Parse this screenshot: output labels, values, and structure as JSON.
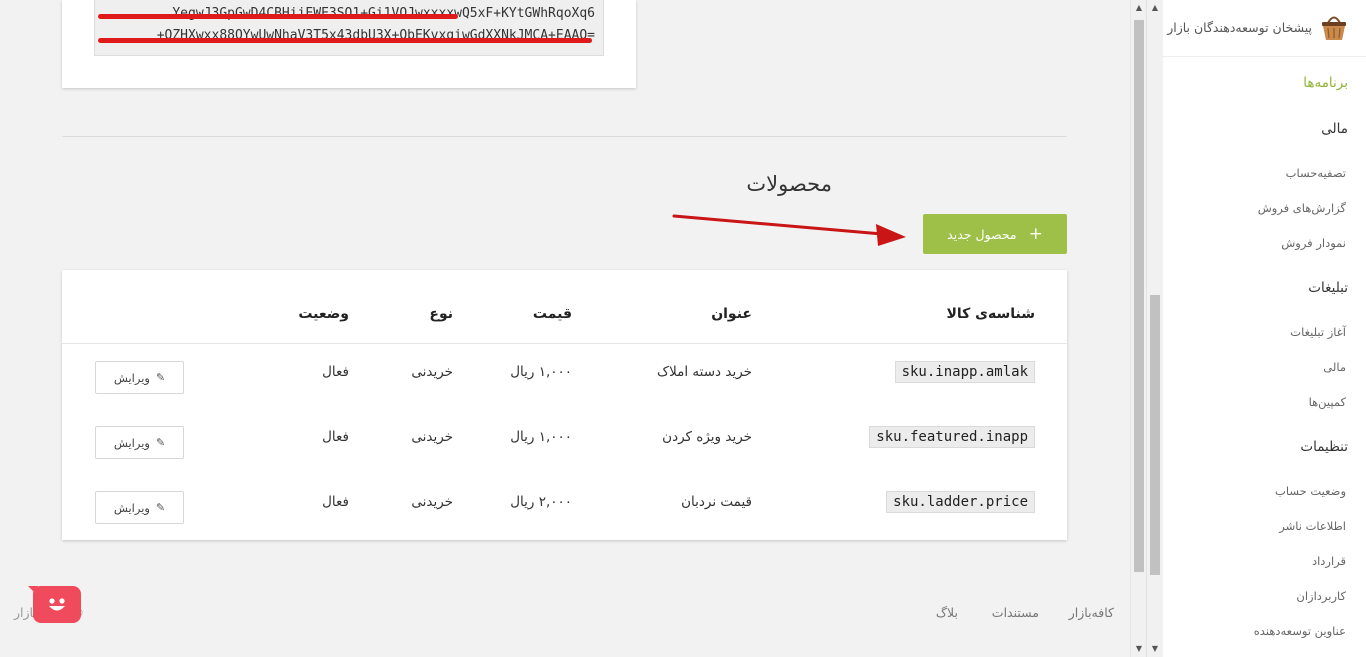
{
  "sidebar": {
    "brand": "پیشخان توسعه‌دهندگان بازار",
    "sections": [
      {
        "label": "برنامه‌ها",
        "active": true
      },
      {
        "label": "مالی"
      },
      {
        "label": "تبلیغات"
      },
      {
        "label": "تنظیمات"
      }
    ],
    "finance_items": [
      "تصفیه‌حساب",
      "گزارش‌های فروش",
      "نمودار فروش"
    ],
    "ads_items": [
      "آغاز تبلیغات",
      "مالی",
      "کمپین‌ها"
    ],
    "settings_items": [
      "وضعیت حساب",
      "اطلاعات ناشر",
      "قرارداد",
      "کاربردازان",
      "عناوین توسعه‌دهنده"
    ]
  },
  "key_card": {
    "line1": "YegwJ3GpGwD4CBHiiEWE3SQ1+Gi1VOJwxxxxwQ5xF+KYtGWhRqoXq6",
    "line2": "+OZHXwxx88QYwUwNhaV3T5x43dbU3X+QbEKvxqiwGdXXNkJMCA+EAAQ="
  },
  "products": {
    "title": "محصولات",
    "new_button": "محصول جدید",
    "headers": {
      "sku": "شناسه‌ی کالا",
      "title": "عنوان",
      "price": "قیمت",
      "type": "نوع",
      "status": "وضعیت"
    },
    "rows": [
      {
        "sku": "sku.inapp.amlak",
        "title": "خرید دسته املاک",
        "price": "۱,۰۰۰ ریال",
        "type": "خریدنی",
        "status": "فعال",
        "edit": "ویرایش"
      },
      {
        "sku": "sku.featured.inapp",
        "title": "خرید ویژه کردن",
        "price": "۱,۰۰۰ ریال",
        "type": "خریدنی",
        "status": "فعال",
        "edit": "ویرایش"
      },
      {
        "sku": "sku.ladder.price",
        "title": "قیمت نردبان",
        "price": "۲,۰۰۰ ریال",
        "type": "خریدنی",
        "status": "فعال",
        "edit": "ویرایش"
      }
    ]
  },
  "footer": {
    "links": [
      "کافه‌بازار",
      "مستندات",
      "بلاگ"
    ],
    "copyright": "© ۲۰۱۷ بازار"
  },
  "colors": {
    "accent_green": "#9ec048",
    "active_nav": "#8fb539",
    "annotation_red": "#e01a1a",
    "chat_badge": "#ef4b5d"
  }
}
